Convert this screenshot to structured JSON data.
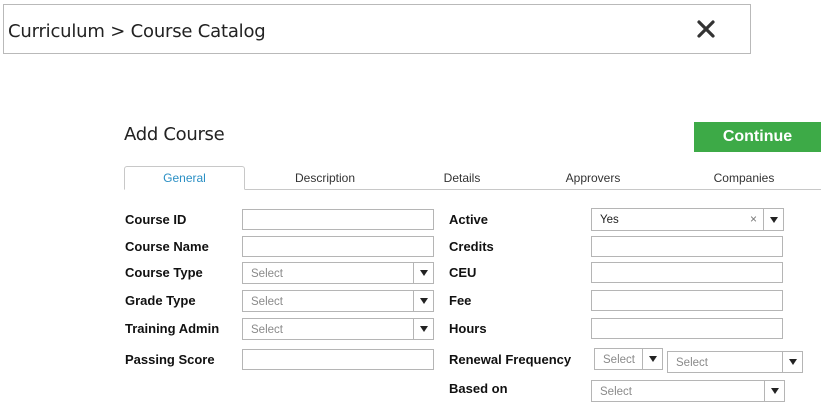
{
  "header": {
    "breadcrumb": "Curriculum > Course Catalog"
  },
  "page": {
    "title": "Add Course",
    "continue_label": "Continue"
  },
  "tabs": [
    {
      "label": "General",
      "active": true
    },
    {
      "label": "Description",
      "active": false
    },
    {
      "label": "Details",
      "active": false
    },
    {
      "label": "Approvers",
      "active": false
    },
    {
      "label": "Companies",
      "active": false
    }
  ],
  "form": {
    "left": {
      "course_id": {
        "label": "Course ID",
        "value": ""
      },
      "course_name": {
        "label": "Course Name",
        "value": ""
      },
      "course_type": {
        "label": "Course Type",
        "value": "Select"
      },
      "grade_type": {
        "label": "Grade Type",
        "value": "Select"
      },
      "training_admin": {
        "label": "Training Admin",
        "value": "Select"
      },
      "passing_score": {
        "label": "Passing Score",
        "value": ""
      }
    },
    "right": {
      "active": {
        "label": "Active",
        "value": "Yes",
        "clear_glyph": "×"
      },
      "credits": {
        "label": "Credits",
        "value": ""
      },
      "ceu": {
        "label": "CEU",
        "value": ""
      },
      "fee": {
        "label": "Fee",
        "value": ""
      },
      "hours": {
        "label": "Hours",
        "value": ""
      },
      "renewal_frequency": {
        "label": "Renewal Frequency",
        "value_number": "Select",
        "value_unit": "Select"
      },
      "based_on": {
        "label": "Based on",
        "value": "Select"
      }
    }
  },
  "colors": {
    "accent_green": "#3daa47",
    "active_tab_text": "#2a8fc4",
    "border": "#b5b5b5"
  },
  "icons": {
    "close": "close-icon",
    "dropdown": "chevron-down-icon"
  }
}
